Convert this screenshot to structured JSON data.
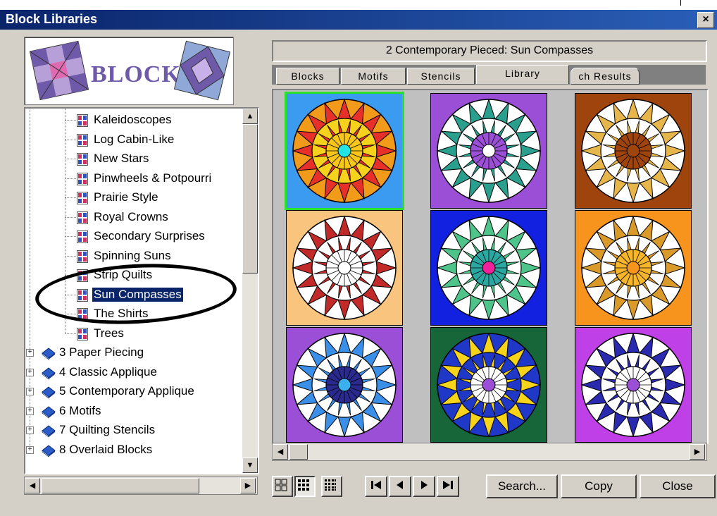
{
  "window": {
    "title": "Block Libraries",
    "close_label": "×"
  },
  "logo": {
    "text": "BLOCKS"
  },
  "tree": {
    "leaves": [
      "Kaleidoscopes",
      "Log Cabin-Like",
      "New Stars",
      "Pinwheels & Potpourri",
      "Prairie Style",
      "Royal Crowns",
      "Secondary Surprises",
      "Spinning Suns",
      "Strip Quilts",
      "Sun Compasses",
      "The Shirts",
      "Trees"
    ],
    "selected": "Sun Compasses",
    "books": [
      "3 Paper Piecing",
      "4 Classic Applique",
      "5 Contemporary Applique",
      "6 Motifs",
      "7 Quilting Stencils",
      "8 Overlaid Blocks"
    ]
  },
  "header": {
    "text": "2 Contemporary Pieced:   Sun Compasses"
  },
  "tabs": [
    "Blocks",
    "Motifs",
    "Stencils",
    "Library",
    "ch Results"
  ],
  "active_tab": "Library",
  "buttons": {
    "search": "Search...",
    "copy": "Copy",
    "close": "Close"
  },
  "nav": {
    "first": "⏮",
    "prev": "◀",
    "next": "▶",
    "last": "⏭"
  },
  "colors": {
    "title_bar": "#0a246a",
    "selection": "#0a246a",
    "selected_block_outline": "#2be02b"
  },
  "blocks": [
    {
      "bg": "#3a9bf0",
      "outer": "#f29a1a",
      "points": "#e8302a",
      "alt": "#f6d21c",
      "inner": "#f9c61a",
      "center": "#22e4e4",
      "selected": true
    },
    {
      "bg": "#9b4fd6",
      "outer": "#ffffff",
      "points": "#2a9f8e",
      "alt": "#ffffff",
      "inner": "#9b4fd6",
      "center": "#ffffff",
      "selected": false
    },
    {
      "bg": "#a0440e",
      "outer": "#ffffff",
      "points": "#e7b64a",
      "alt": "#ffffff",
      "inner": "#a0440e",
      "center": "#a0440e",
      "selected": false
    },
    {
      "bg": "#f8c47e",
      "outer": "#ffffff",
      "points": "#c22a2a",
      "alt": "#ffffff",
      "inner": "#ffffff",
      "center": "#ffffff",
      "selected": false
    },
    {
      "bg": "#1220e0",
      "outer": "#ffffff",
      "points": "#4fc48a",
      "alt": "#ffffff",
      "inner": "#2aa7a0",
      "center": "#f0219a",
      "selected": false
    },
    {
      "bg": "#f7941d",
      "outer": "#ffffff",
      "points": "#d99a2a",
      "alt": "#ffffff",
      "inner": "#f7b52a",
      "center": "#f7941d",
      "selected": false
    },
    {
      "bg": "#9b4fd6",
      "outer": "#ffffff",
      "points": "#3a8fe8",
      "alt": "#ffffff",
      "inner": "#2a2a8e",
      "center": "#3ab0f0",
      "selected": false
    },
    {
      "bg": "#16663a",
      "outer": "#2038c8",
      "points": "#f7d41a",
      "alt": "#2038c8",
      "inner": "#ffffff",
      "center": "#9b4fd6",
      "selected": false
    },
    {
      "bg": "#c040e8",
      "outer": "#ffffff",
      "points": "#2a2ab0",
      "alt": "#ffffff",
      "inner": "#ffffff",
      "center": "#9b4fd6",
      "selected": false
    }
  ]
}
